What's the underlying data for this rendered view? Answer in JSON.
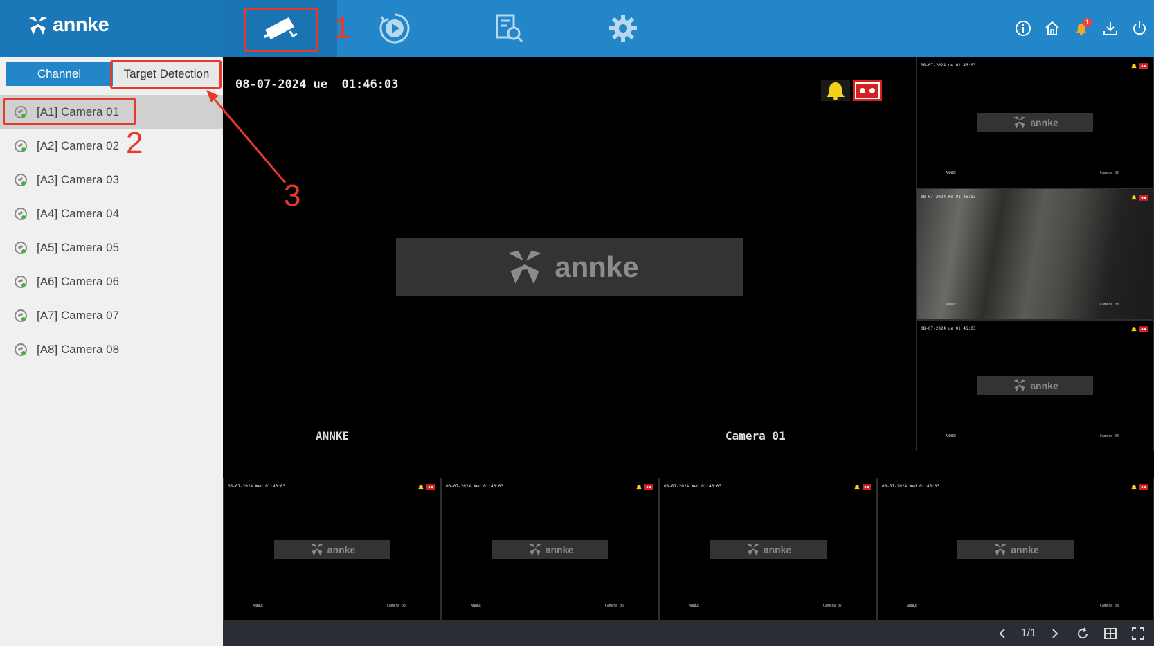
{
  "brand": {
    "name": "annke"
  },
  "header": {
    "nav": [
      {
        "id": "live",
        "icon": "camera-icon",
        "active": true
      },
      {
        "id": "playback",
        "icon": "playback-icon",
        "active": false
      },
      {
        "id": "search",
        "icon": "file-search-icon",
        "active": false
      },
      {
        "id": "settings",
        "icon": "gear-icon",
        "active": false
      }
    ],
    "right_icons": [
      "info-icon",
      "home-icon",
      "bell-icon",
      "download-icon",
      "power-icon"
    ],
    "notification_count": "1"
  },
  "sidebar": {
    "tabs": {
      "channel": "Channel",
      "target": "Target Detection"
    },
    "channels": [
      "[A1] Camera 01",
      "[A2] Camera 02",
      "[A3] Camera 03",
      "[A4] Camera 04",
      "[A5] Camera 05",
      "[A6] Camera 06",
      "[A7] Camera 07",
      "[A8] Camera 08"
    ]
  },
  "main_view": {
    "timestamp": "08-07-2024 ue  01:46:03",
    "osd_left": "ANNKE",
    "osd_right": "Camera 01",
    "logo": "annke"
  },
  "tiles": [
    {
      "time": "08-07-2024 ue 01:46:03",
      "left": "ANNKE",
      "right": "Camera 02"
    },
    {
      "time": "08-07-2024 Wd 01:46:03",
      "left": "ANNKE",
      "right": "Camera 03"
    },
    {
      "time": "08-07-2024 ue 01:46:03",
      "left": "ANNKE",
      "right": "Camera 04"
    },
    {
      "time": "08-07-2024 Wed 01:46:03",
      "left": "ANNKE",
      "right": "Camera 05"
    },
    {
      "time": "08-07-2024 Wed 01:46:03",
      "left": "ANNKE",
      "right": "Camera 06"
    },
    {
      "time": "08-07-2024 Wed 01:46:03",
      "left": "ANNKE",
      "right": "Camera 07"
    },
    {
      "time": "08-07-2024 Wed 01:46:03",
      "left": "ANNKE",
      "right": "Camera 08"
    }
  ],
  "bottom_bar": {
    "page": "1/1"
  },
  "annotations": [
    "1",
    "2",
    "3"
  ],
  "colors": {
    "accent": "#2286c9",
    "annotation": "#e53a2a",
    "sidebar_bg": "#f0f0f0"
  }
}
